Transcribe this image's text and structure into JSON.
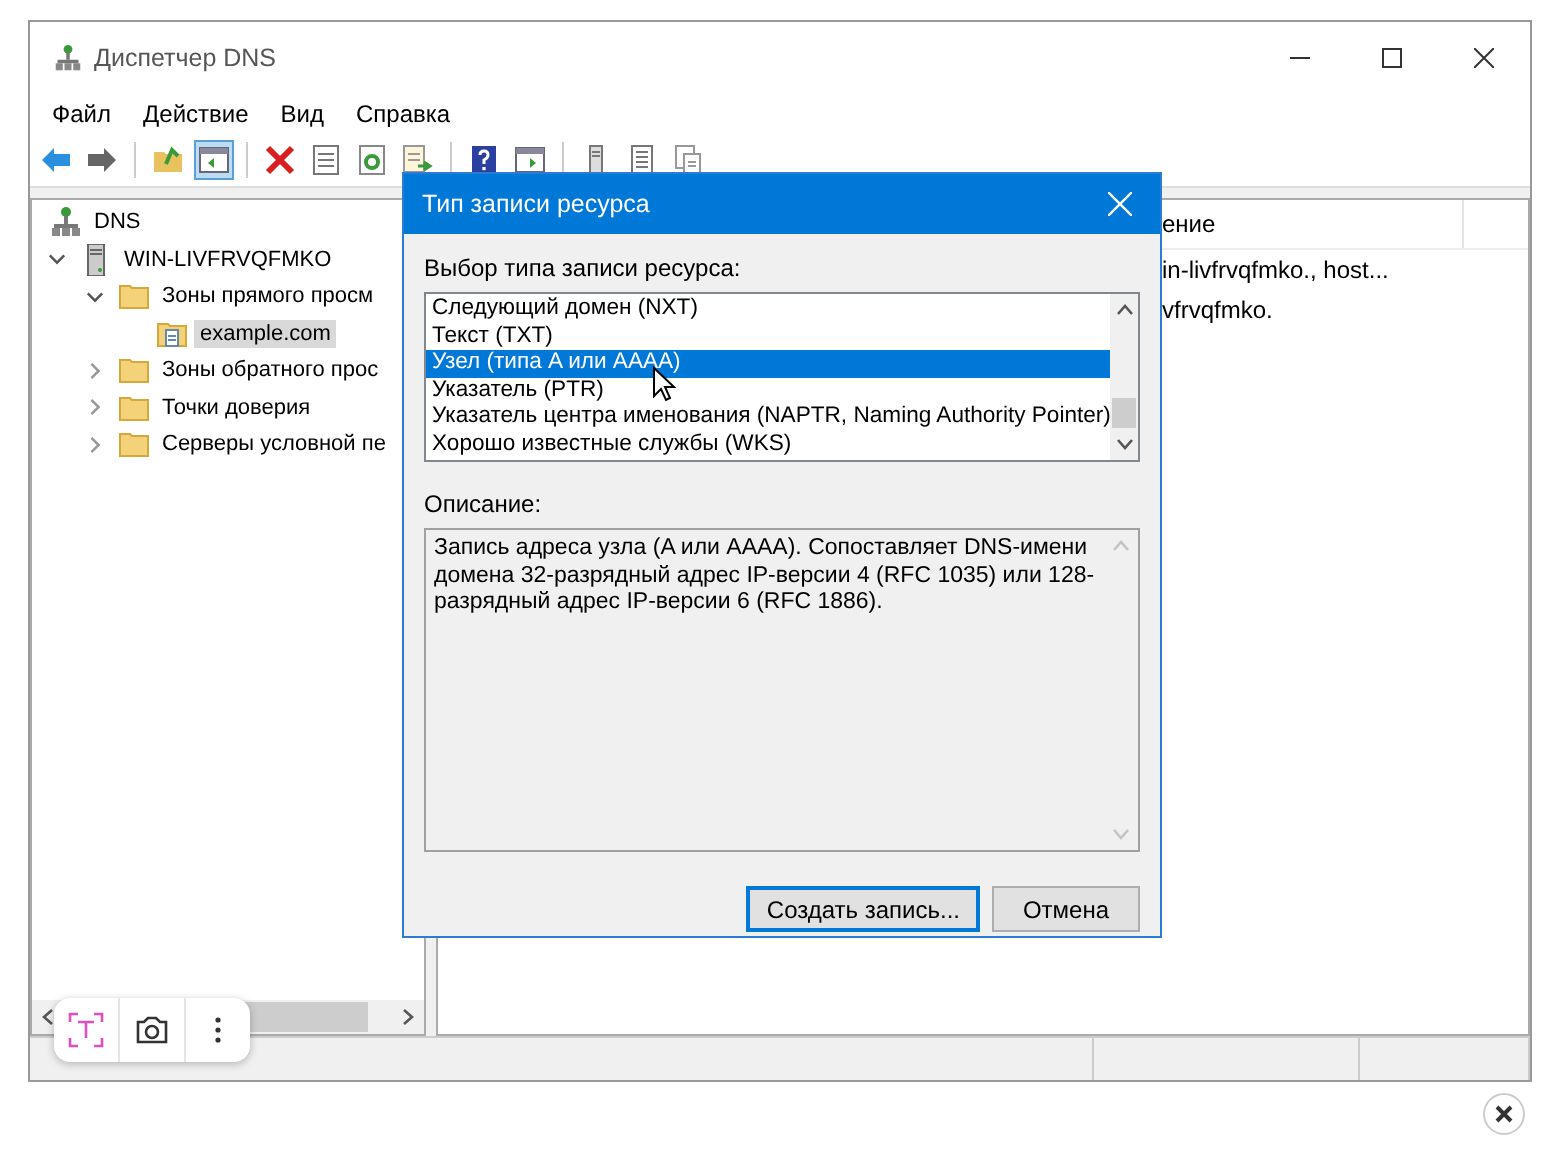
{
  "window": {
    "title": "Диспетчер DNS"
  },
  "menu": [
    "Файл",
    "Действие",
    "Вид",
    "Справка"
  ],
  "toolbar": [
    {
      "kind": "back",
      "pressed": false
    },
    {
      "kind": "forward",
      "pressed": false
    },
    {
      "kind": "separator"
    },
    {
      "kind": "up",
      "pressed": false
    },
    {
      "kind": "tree",
      "pressed": true
    },
    {
      "kind": "separator"
    },
    {
      "kind": "delete",
      "pressed": false
    },
    {
      "kind": "properties",
      "pressed": false
    },
    {
      "kind": "refresh",
      "pressed": false
    },
    {
      "kind": "export",
      "pressed": false
    },
    {
      "kind": "separator"
    },
    {
      "kind": "help",
      "pressed": false
    },
    {
      "kind": "pane",
      "pressed": false
    },
    {
      "kind": "separator"
    },
    {
      "kind": "server",
      "pressed": false
    },
    {
      "kind": "list",
      "pressed": false
    },
    {
      "kind": "copy",
      "pressed": false
    }
  ],
  "tree": [
    {
      "label": "DNS",
      "kind": "root",
      "selected": false,
      "children": [
        {
          "label": "WIN-LIVFRVQFMKO",
          "kind": "server",
          "expanded": true,
          "selected": false,
          "children": [
            {
              "label": "Зоны прямого просм",
              "kind": "folder",
              "expanded": true,
              "selected": false,
              "children": [
                {
                  "label": "example.com",
                  "kind": "zone",
                  "selected": true
                }
              ]
            },
            {
              "label": "Зоны обратного прос",
              "kind": "folder",
              "expanded": false,
              "selected": false
            },
            {
              "label": "Точки доверия",
              "kind": "folder",
              "expanded": false,
              "selected": false
            },
            {
              "label": "Серверы условной пе",
              "kind": "folder",
              "expanded": false,
              "selected": false
            }
          ]
        }
      ]
    }
  ],
  "details": {
    "columns": [
      "ение"
    ],
    "rows": [
      [
        "in-livfrvqfmko., host..."
      ],
      [
        "vfrvqfmko."
      ]
    ]
  },
  "dialog": {
    "title": "Тип записи ресурса",
    "list_label": "Выбор типа записи ресурса:",
    "record_types": [
      {
        "label": "Следующий домен (NXT)",
        "selected": false
      },
      {
        "label": "Текст (TXT)",
        "selected": false
      },
      {
        "label": "Узел (типа A или AAAA)",
        "selected": true
      },
      {
        "label": "Указатель (PTR)",
        "selected": false
      },
      {
        "label": "Указатель центра именования (NAPTR, Naming Authority Pointer)",
        "selected": false
      },
      {
        "label": "Хорошо известные службы (WKS)",
        "selected": false
      }
    ],
    "description_label": "Описание:",
    "description": "Запись адреса узла (A или AAAA). Сопоставляет DNS-имени домена 32-разрядный адрес IP-версии 4 (RFC 1035) или 128-разрядный адрес IP-версии 6 (RFC 1886).",
    "buttons": [
      {
        "label": "Создать запись...",
        "default": true
      },
      {
        "label": "Отмена",
        "default": false
      }
    ]
  }
}
